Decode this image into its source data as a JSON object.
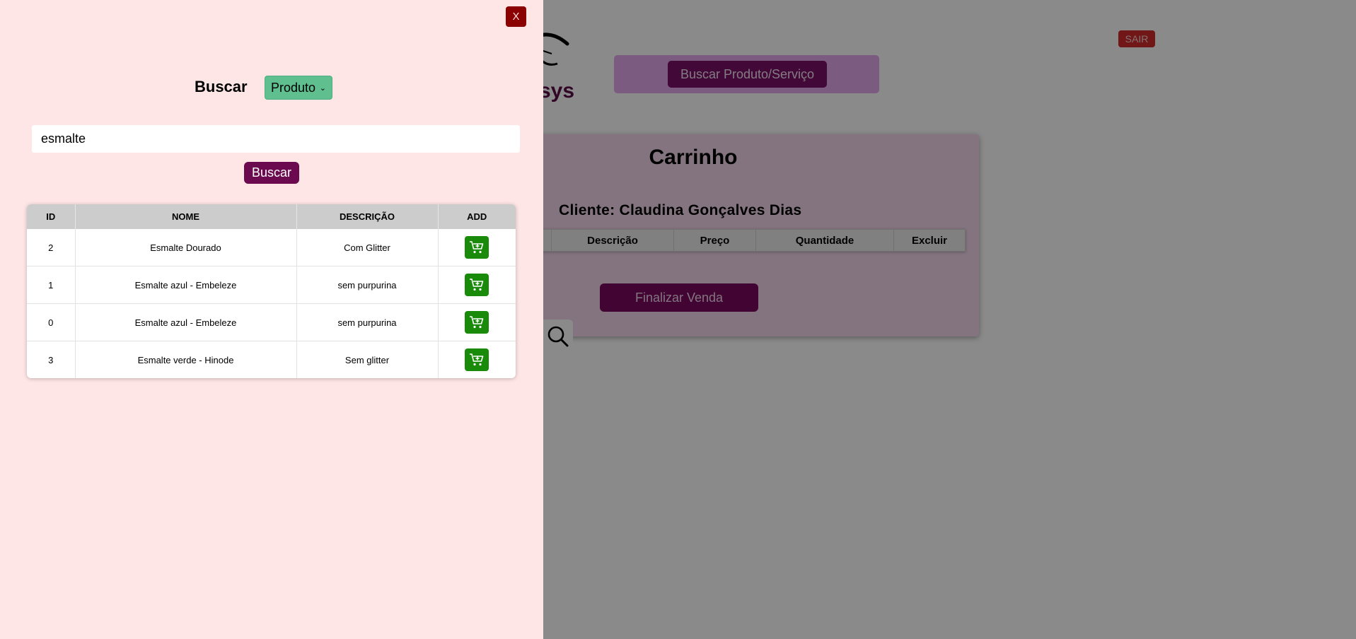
{
  "background": {
    "brand_partial": "sys",
    "logout_label": "SAIR",
    "search_product_service_label": "Buscar Produto/Serviço",
    "cart": {
      "title": "Carrinho",
      "client_line": "Cliente: Claudina Gonçalves Dias",
      "columns": [
        "Descrição",
        "Preço",
        "Quantidade",
        "Excluir"
      ],
      "finish_label": "Finalizar Venda"
    }
  },
  "modal": {
    "close_label": "X",
    "search_label": "Buscar",
    "type_select": {
      "selected": "Produto"
    },
    "search_input": {
      "value": "esmalte"
    },
    "search_button_label": "Buscar",
    "table": {
      "headers": [
        "ID",
        "NOME",
        "DESCRIÇÃO",
        "ADD"
      ],
      "rows": [
        {
          "id": "2",
          "name": "Esmalte Dourado",
          "description": "Com Glitter"
        },
        {
          "id": "1",
          "name": "Esmalte azul - Embeleze",
          "description": "sem purpurina"
        },
        {
          "id": "0",
          "name": "Esmalte azul - Embeleze",
          "description": "sem purpurina"
        },
        {
          "id": "3",
          "name": "Esmalte verde - Hinode",
          "description": "Sem glitter"
        }
      ],
      "add_icon": "cart-plus-icon"
    }
  },
  "colors": {
    "modal_background": "#ffe6e6",
    "primary": "#6b0a4f",
    "add_green": "#1a8a0a",
    "select_green": "#5fbf8f",
    "close_red": "#8b0000"
  }
}
